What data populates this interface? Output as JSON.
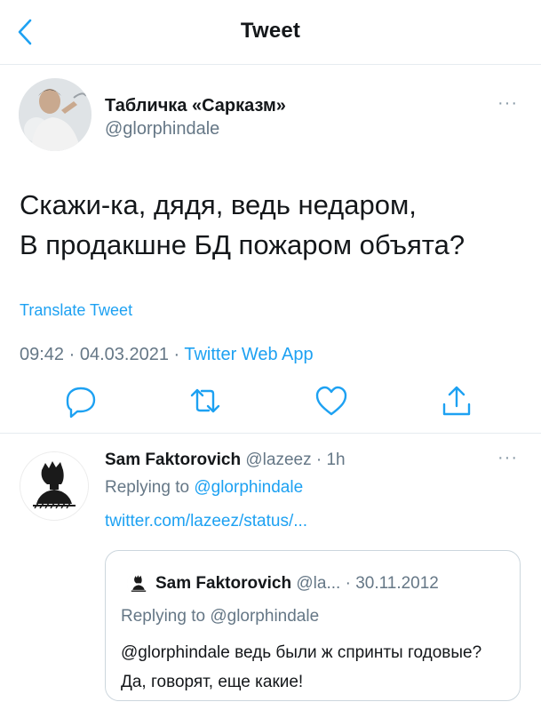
{
  "header": {
    "title": "Tweet",
    "back_icon": "chevron-left-icon",
    "accent": "#1da1f2"
  },
  "tweet": {
    "author_name": "Табличка «Сарказм»",
    "author_handle": "@glorphindale",
    "more": "···",
    "text_lines": [
      "Скажи-ка, дядя, ведь недаром,",
      "В продакшне БД пожаром объята?"
    ],
    "translate": "Translate Tweet",
    "time": "09:42",
    "date": "04.03.2021",
    "separator": " · ",
    "app": "Twitter Web App",
    "actions": [
      "reply-icon",
      "retweet-icon",
      "like-icon",
      "share-icon"
    ]
  },
  "reply": {
    "author_name": "Sam Faktorovich",
    "handle_time": "@lazeez · 1h",
    "more": "···",
    "replying_prefix": "Replying to ",
    "replying_mention": "@glorphindale",
    "link": "twitter.com/lazeez/status/...",
    "quote": {
      "author_name": "Sam Faktorovich",
      "meta": "@la... · 30.11.2012",
      "replying": "Replying to @glorphindale",
      "text": "@glorphindale ведь были ж спринты годовые? Да, говорят, еще какие!"
    }
  }
}
